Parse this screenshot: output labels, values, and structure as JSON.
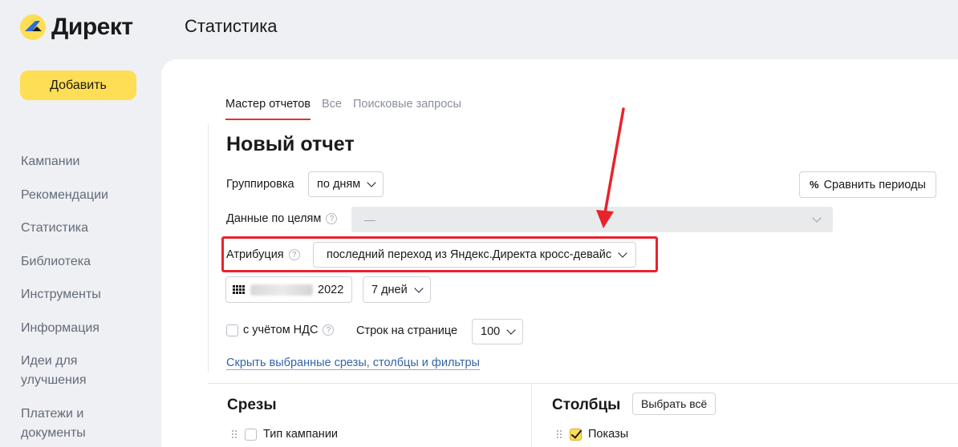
{
  "app": {
    "logo_text": "Директ",
    "page_title": "Статистика"
  },
  "sidebar": {
    "add_button": "Добавить",
    "items": [
      {
        "label": "Кампании"
      },
      {
        "label": "Рекомендации"
      },
      {
        "label": "Статистика"
      },
      {
        "label": "Библиотека"
      },
      {
        "label": "Инструменты"
      },
      {
        "label": "Информация"
      },
      {
        "label": "Идеи для улучшения"
      },
      {
        "label": "Платежи и документы"
      }
    ]
  },
  "tabs": [
    {
      "label": "Мастер отчетов",
      "active": true
    },
    {
      "label": "Все",
      "active": false
    },
    {
      "label": "Поисковые запросы",
      "active": false
    }
  ],
  "report": {
    "title": "Новый отчет",
    "grouping_label": "Группировка",
    "grouping_value": "по дням",
    "goals_label": "Данные по целям",
    "goals_value": "—",
    "attribution_label": "Атрибуция",
    "attribution_value": "последний переход из Яндекс.Директа кросс-девайс",
    "compare_button": "Сравнить периоды",
    "compare_icon": "%",
    "date_year": "2022",
    "period_value": "7 дней",
    "vat_label": "с учётом НДС",
    "rows_label": "Строк на странице",
    "rows_value": "100",
    "hide_link": "Скрыть выбранные срезы, столбцы и фильтры"
  },
  "slices": {
    "title": "Срезы",
    "items": [
      {
        "label": "Тип кампании",
        "checked": false
      }
    ]
  },
  "columns": {
    "title": "Столбцы",
    "select_all": "Выбрать всё",
    "items": [
      {
        "label": "Показы",
        "checked": true
      }
    ]
  },
  "colors": {
    "accent_yellow": "#fdde55",
    "highlight_red": "#e8232b",
    "link_blue": "#3365a8"
  }
}
